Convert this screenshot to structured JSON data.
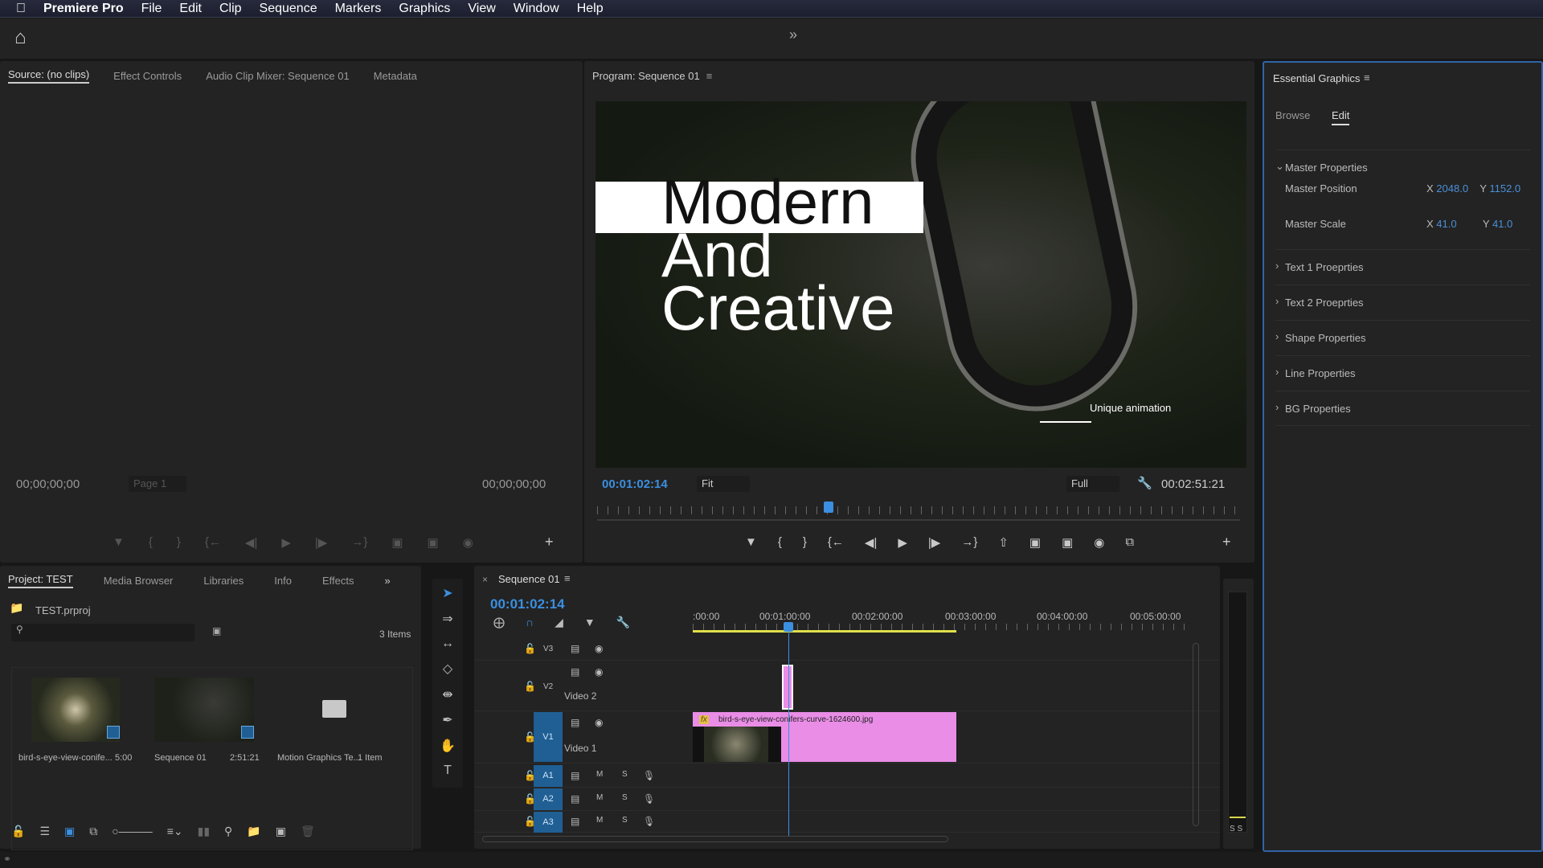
{
  "menubar": {
    "app": "Premiere Pro",
    "items": [
      "File",
      "Edit",
      "Clip",
      "Sequence",
      "Markers",
      "Graphics",
      "View",
      "Window",
      "Help"
    ]
  },
  "source": {
    "tabs": [
      "Source: (no clips)",
      "Effect Controls",
      "Audio Clip Mixer: Sequence 01",
      "Metadata"
    ],
    "timecode_left": "00;00;00;00",
    "page": "Page 1",
    "timecode_right": "00;00;00;00"
  },
  "program": {
    "title": "Program: Sequence 01",
    "video": {
      "line1": "Modern",
      "line2": "And",
      "line3": "Creative",
      "caption": "Unique animation"
    },
    "timecode": "00:01:02:14",
    "fit": "Fit",
    "quality": "Full",
    "duration": "00:02:51:21",
    "playhead_fraction": 0.36
  },
  "essential": {
    "title": "Essential Graphics",
    "tabs": [
      "Browse",
      "Edit"
    ],
    "active_tab": "Edit",
    "master": {
      "label": "Master Properties",
      "position_label": "Master Position",
      "pos_x": "2048.0",
      "pos_y": "1152.0",
      "scale_label": "Master Scale",
      "scale_x": "41.0",
      "scale_y": "41.0",
      "x": "X",
      "y": "Y"
    },
    "sections": [
      "Text 1 Proeprties",
      "Text 2 Proeprties",
      "Shape Properties",
      "Line Properties",
      "BG Properties"
    ]
  },
  "project": {
    "tabs": [
      "Project: TEST",
      "Media Browser",
      "Libraries",
      "Info",
      "Effects"
    ],
    "file": "TEST.prproj",
    "count": "3 Items",
    "items": [
      {
        "name": "bird-s-eye-view-conife...",
        "meta": "5:00"
      },
      {
        "name": "Sequence 01",
        "meta": "2:51:21"
      },
      {
        "name": "Motion Graphics Te...",
        "meta": "1 Item"
      }
    ]
  },
  "timeline": {
    "title": "Sequence 01",
    "timecode": "00:01:02:14",
    "ruler": [
      ":00:00",
      "00:01:00:00",
      "00:02:00:00",
      "00:03:00:00",
      "00:04:00:00",
      "00:05:00:00"
    ],
    "tracks": {
      "v3": "V3",
      "v2": "V2",
      "v2_name": "Video 2",
      "v1": "V1",
      "v1_name": "Video 1",
      "a1": "A1",
      "a2": "A2",
      "a3": "A3",
      "m": "M",
      "s": "S"
    },
    "clip": "bird-s-eye-view-conifers-curve-1624600.jpg",
    "fx": "fx"
  },
  "meter": {
    "label": "S S"
  },
  "colors": {
    "accent": "#3b8fe0",
    "clip": "#e98de6",
    "track_active": "#1f5f94",
    "work_area": "#e1e04a"
  }
}
